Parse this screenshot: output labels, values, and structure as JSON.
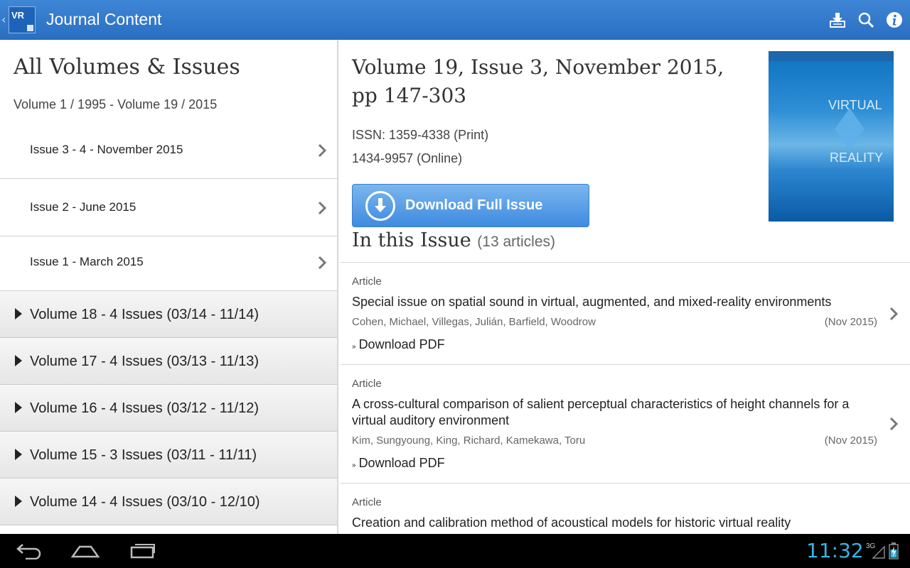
{
  "actionbar": {
    "app_icon_text": "VR",
    "title": "Journal Content",
    "icons": [
      "download-icon",
      "search-icon",
      "info-icon"
    ]
  },
  "left": {
    "heading": "All Volumes & Issues",
    "range": "Volume 1 / 1995 - Volume 19 / 2015",
    "issues": [
      {
        "label": "Issue 3 - 4 - November 2015"
      },
      {
        "label": "Issue 2 - June 2015"
      },
      {
        "label": "Issue 1 - March 2015"
      }
    ],
    "volumes": [
      {
        "label": "Volume 18 - 4 Issues (03/14 - 11/14)"
      },
      {
        "label": "Volume 17 - 4 Issues (03/13 - 11/13)"
      },
      {
        "label": "Volume 16 - 4 Issues (03/12 - 11/12)"
      },
      {
        "label": "Volume 15 - 3 Issues (03/11 - 11/11)"
      },
      {
        "label": "Volume 14 - 4 Issues (03/10 - 12/10)"
      }
    ]
  },
  "right": {
    "volume_title": "Volume 19, Issue 3, November 2015, pp 147-303",
    "issn_print": "ISSN: 1359-4338 (Print)",
    "issn_online": "1434-9957 (Online)",
    "cover": {
      "line1": "VIRTUAL",
      "line2": "REALITY"
    },
    "download_label": "Download Full Issue",
    "in_issue_label": "In this Issue",
    "in_issue_count": "(13 articles)",
    "articles": [
      {
        "kind": "Article",
        "title": "Special issue on spatial sound in virtual, augmented, and mixed-reality environments",
        "authors": "Cohen, Michael, Villegas, Julián, Barfield, Woodrow",
        "date": "(Nov 2015)",
        "pdf": "Download PDF"
      },
      {
        "kind": "Article",
        "title": "A cross-cultural comparison of salient perceptual characteristics of height channels for a virtual auditory environment",
        "authors": "Kim, Sungyoung, King, Richard, Kamekawa, Toru",
        "date": "(Nov 2015)",
        "pdf": "Download PDF"
      },
      {
        "kind": "Article",
        "title": "Creation and calibration method of acoustical models for historic virtual reality"
      }
    ]
  },
  "status": {
    "time": "11:32",
    "network": "3G"
  },
  "colors": {
    "actionbar": "#2a6fc2",
    "accent": "#33b5e5",
    "button": "#3e8be0"
  }
}
